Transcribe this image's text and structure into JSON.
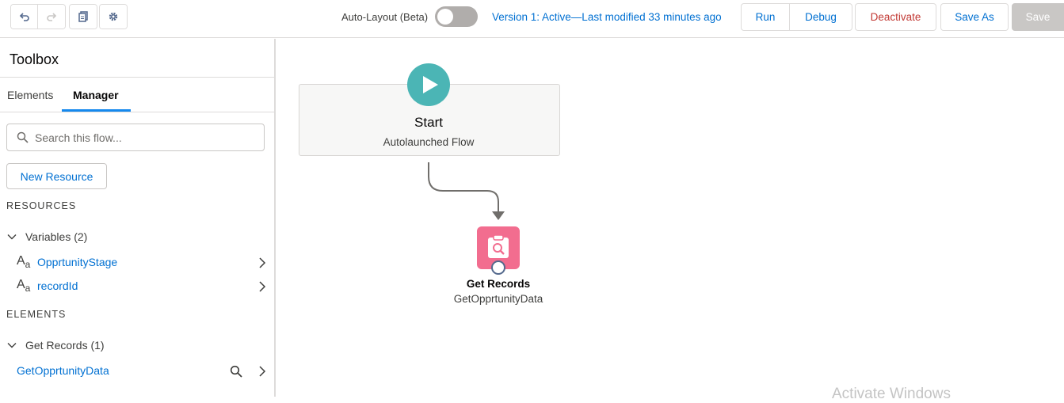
{
  "toolbar": {
    "auto_layout_label": "Auto-Layout (Beta)",
    "auto_layout_on": false,
    "version_text": "Version 1: Active—Last modified 33 minutes ago",
    "run_label": "Run",
    "debug_label": "Debug",
    "deactivate_label": "Deactivate",
    "save_as_label": "Save As",
    "save_label": "Save",
    "icons": [
      "undo-icon",
      "redo-icon",
      "copy-icon",
      "settings-icon"
    ]
  },
  "sidebar": {
    "title": "Toolbox",
    "tabs": [
      {
        "label": "Elements",
        "active": false
      },
      {
        "label": "Manager",
        "active": true
      }
    ],
    "search_placeholder": "Search this flow...",
    "new_resource_label": "New Resource",
    "resources_heading": "RESOURCES",
    "variables_group": "Variables (2)",
    "variables": [
      {
        "type_icon": "text-type-icon",
        "name": "OpprtunityStage"
      },
      {
        "type_icon": "text-type-icon",
        "name": "recordId"
      }
    ],
    "elements_heading": "ELEMENTS",
    "get_records_group": "Get Records (1)",
    "elements": [
      {
        "name": "GetOpprtunityData"
      }
    ]
  },
  "canvas": {
    "start_title": "Start",
    "start_subtitle": "Autolaunched Flow",
    "node_title": "Get Records",
    "node_subtitle": "GetOpprtunityData"
  },
  "colors": {
    "link": "#0070d2",
    "start_circle": "#4bb5b5",
    "get_records_icon": "#f26d8f",
    "deactivate": "#c23934"
  },
  "watermark": "Activate Windows"
}
